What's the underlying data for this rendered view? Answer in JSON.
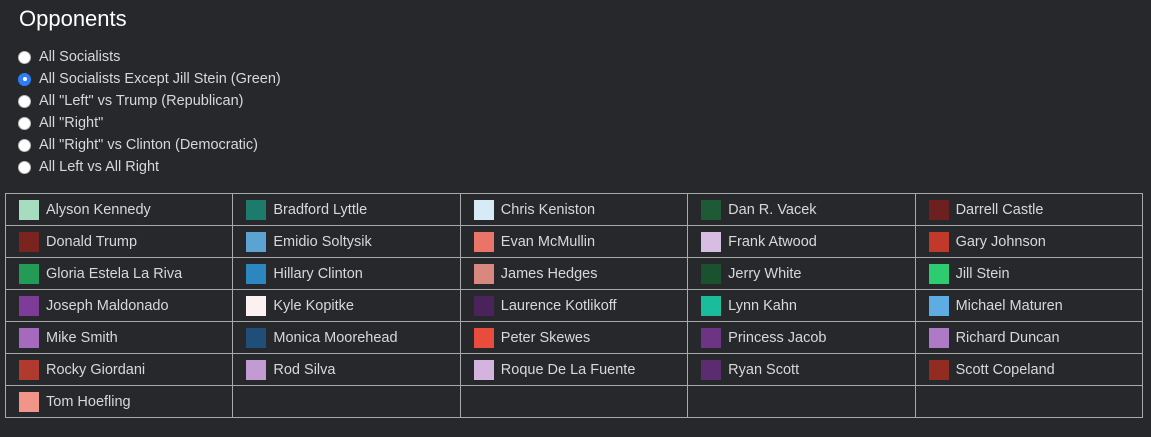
{
  "title": "Opponents",
  "options": [
    {
      "label": "All Socialists",
      "checked": false
    },
    {
      "label": "All Socialists Except Jill Stein (Green)",
      "checked": true
    },
    {
      "label": "All \"Left\" vs Trump (Republican)",
      "checked": false
    },
    {
      "label": "All \"Right\"",
      "checked": false
    },
    {
      "label": "All \"Right\" vs Clinton (Democratic)",
      "checked": false
    },
    {
      "label": "All Left vs All Right",
      "checked": false
    }
  ],
  "candidates": [
    {
      "name": "Alyson Kennedy",
      "color": "#a8dcc0"
    },
    {
      "name": "Bradford Lyttle",
      "color": "#1e7a6a"
    },
    {
      "name": "Chris Keniston",
      "color": "#d6eaf8"
    },
    {
      "name": "Dan R. Vacek",
      "color": "#1e5a36"
    },
    {
      "name": "Darrell Castle",
      "color": "#6e1f1f"
    },
    {
      "name": "Donald Trump",
      "color": "#7a2420"
    },
    {
      "name": "Emidio Soltysik",
      "color": "#5da3d2"
    },
    {
      "name": "Evan McMullin",
      "color": "#ea7468"
    },
    {
      "name": "Frank Atwood",
      "color": "#d7bde2"
    },
    {
      "name": "Gary Johnson",
      "color": "#c0392b"
    },
    {
      "name": "Gloria Estela La Riva",
      "color": "#239b56"
    },
    {
      "name": "Hillary Clinton",
      "color": "#2e86c1"
    },
    {
      "name": "James Hedges",
      "color": "#d98880"
    },
    {
      "name": "Jerry White",
      "color": "#1a5230"
    },
    {
      "name": "Jill Stein",
      "color": "#2ecc71"
    },
    {
      "name": "Joseph Maldonado",
      "color": "#7d3c98"
    },
    {
      "name": "Kyle Kopitke",
      "color": "#fdf0f0"
    },
    {
      "name": "Laurence Kotlikoff",
      "color": "#4a235a"
    },
    {
      "name": "Lynn Kahn",
      "color": "#1abc9c"
    },
    {
      "name": "Michael Maturen",
      "color": "#5dade2"
    },
    {
      "name": "Mike Smith",
      "color": "#a569bd"
    },
    {
      "name": "Monica Moorehead",
      "color": "#1f4e79"
    },
    {
      "name": "Peter Skewes",
      "color": "#e74c3c"
    },
    {
      "name": "Princess Jacob",
      "color": "#6c3483"
    },
    {
      "name": "Richard Duncan",
      "color": "#af7ac5"
    },
    {
      "name": "Rocky Giordani",
      "color": "#b03a2e"
    },
    {
      "name": "Rod Silva",
      "color": "#c39bd3"
    },
    {
      "name": "Roque De La Fuente",
      "color": "#d2b4de"
    },
    {
      "name": "Ryan Scott",
      "color": "#5b2c6f"
    },
    {
      "name": "Scott Copeland",
      "color": "#922b21"
    },
    {
      "name": "Tom Hoefling",
      "color": "#f1948a"
    },
    null,
    null,
    null,
    null
  ]
}
